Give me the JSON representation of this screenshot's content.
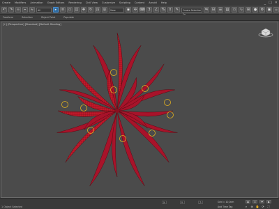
{
  "menu": [
    "Create",
    "Modifiers",
    "Animation",
    "Graph Editors",
    "Rendering",
    "Civil View",
    "Customize",
    "Scripting",
    "Content",
    "Arnold",
    "Help"
  ],
  "window_controls": [
    "_",
    "□",
    "✕"
  ],
  "toolbar": {
    "dropdown_label": "All",
    "view_dropdown": "View",
    "selection_set": "Create Selection Se"
  },
  "ribbon_tabs": [
    "Freeform",
    "Selection",
    "Object Paint",
    "Populate"
  ],
  "viewport": {
    "label": "[+] [Perspective] [Standard] [Default Shading]",
    "background": "#4b4b4b",
    "grid_color": "#3f3f3f",
    "petal_color": "#c0182a",
    "petal_wire_color": "#7a0f18",
    "gizmo_color": "#e0b020"
  },
  "status": {
    "selection": "1 Object Selected",
    "x": "X:",
    "y": "Y:",
    "z": "Z:",
    "grid": "Grid = 10,0cm",
    "add_time_tag": "Add Time Tag",
    "auto_key": "Auto Key",
    "set_key": "Set Key"
  }
}
